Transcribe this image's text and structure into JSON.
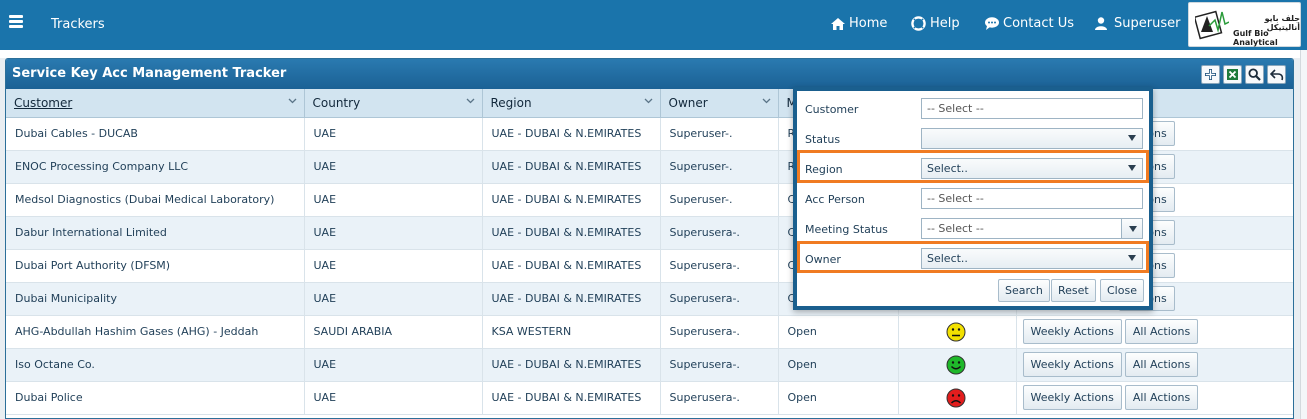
{
  "nav": {
    "app_title": "Trackers",
    "home": "Home",
    "help": "Help",
    "contact": "Contact Us",
    "user": "Superuser",
    "logo_ar": "جلف بايو أناليتيكل",
    "logo_en": "Gulf Bio Analytical"
  },
  "panel": {
    "title": "Service Key Acc Management Tracker",
    "tools": [
      "add-icon",
      "excel-icon",
      "search-icon",
      "back-icon"
    ]
  },
  "table": {
    "columns": [
      "Customer",
      "Country",
      "Region",
      "Owner",
      "M"
    ],
    "rows": [
      {
        "customer": "Dubai Cables - DUCAB",
        "country": "UAE",
        "region": "UAE - DUBAI & N.EMIRATES",
        "owner": "Superuser-.",
        "status": "R",
        "face": "",
        "weekly": "",
        "all": "Actions"
      },
      {
        "customer": "ENOC Processing Company LLC",
        "country": "UAE",
        "region": "UAE - DUBAI & N.EMIRATES",
        "owner": "Superuser-.",
        "status": "R",
        "face": "",
        "weekly": "",
        "all": "Actions"
      },
      {
        "customer": "Medsol Diagnostics (Dubai Medical Laboratory)",
        "country": "UAE",
        "region": "UAE - DUBAI & N.EMIRATES",
        "owner": "Superuser-.",
        "status": "C",
        "face": "",
        "weekly": "",
        "all": "Actions"
      },
      {
        "customer": "Dabur International Limited",
        "country": "UAE",
        "region": "UAE - DUBAI & N.EMIRATES",
        "owner": "Superusera-.",
        "status": "C",
        "face": "",
        "weekly": "",
        "all": "Actions"
      },
      {
        "customer": "Dubai Port Authority (DFSM)",
        "country": "UAE",
        "region": "UAE - DUBAI & N.EMIRATES",
        "owner": "Superusera-.",
        "status": "C",
        "face": "",
        "weekly": "",
        "all": "Actions"
      },
      {
        "customer": "Dubai Municipality",
        "country": "UAE",
        "region": "UAE - DUBAI & N.EMIRATES",
        "owner": "Superusera-.",
        "status": "C",
        "face": "",
        "weekly": "",
        "all": "Actions"
      },
      {
        "customer": "AHG-Abdullah Hashim Gases (AHG) - Jeddah",
        "country": "SAUDI ARABIA",
        "region": "KSA WESTERN",
        "owner": "Superusera-.",
        "status": "Open",
        "face": "neutral",
        "weekly": "Weekly Actions",
        "all": "All Actions"
      },
      {
        "customer": "Iso Octane Co.",
        "country": "UAE",
        "region": "UAE - DUBAI & N.EMIRATES",
        "owner": "Superusera-.",
        "status": "Open",
        "face": "happy",
        "weekly": "Weekly Actions",
        "all": "All Actions"
      },
      {
        "customer": "Dubai Police",
        "country": "UAE",
        "region": "UAE - DUBAI & N.EMIRATES",
        "owner": "Superusera-.",
        "status": "Open",
        "face": "sad",
        "weekly": "Weekly Actions",
        "all": "All Actions"
      }
    ]
  },
  "search_form": {
    "customer_label": "Customer",
    "customer_placeholder": "-- Select --",
    "status_label": "Status",
    "status_value": "",
    "region_label": "Region",
    "region_value": "Select..",
    "acc_person_label": "Acc Person",
    "acc_person_placeholder": "-- Select --",
    "meeting_status_label": "Meeting Status",
    "meeting_status_placeholder": "-- Select --",
    "owner_label": "Owner",
    "owner_value": "Select..",
    "search_btn": "Search",
    "reset_btn": "Reset",
    "close_btn": "Close"
  },
  "colors": {
    "navbar": "#1a74ab",
    "highlight": "#f07b22",
    "face_neutral": "#f2e000",
    "face_happy": "#1fb82a",
    "face_sad": "#e21d1d"
  }
}
